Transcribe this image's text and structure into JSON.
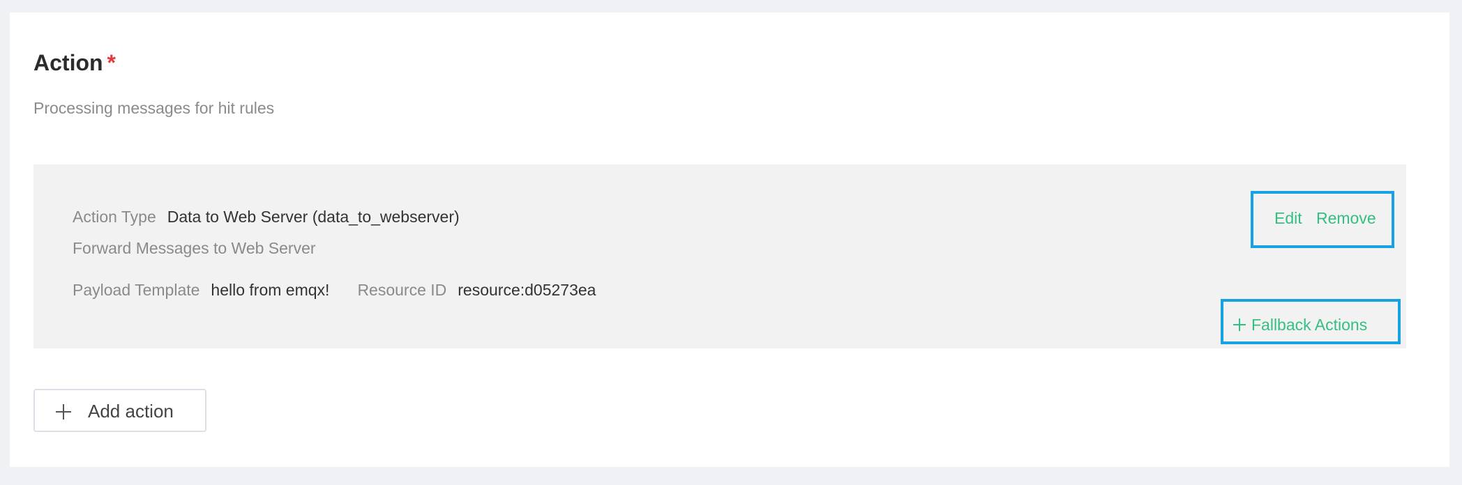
{
  "section": {
    "title": "Action",
    "required_mark": "*",
    "subtitle": "Processing messages for hit rules"
  },
  "action": {
    "type_label": "Action Type",
    "type_value": "Data to Web Server (data_to_webserver)",
    "description": "Forward Messages to Web Server",
    "payload_label": "Payload Template",
    "payload_value": "hello from emqx!",
    "resource_label": "Resource ID",
    "resource_value": "resource:d05273ea",
    "edit_label": "Edit",
    "remove_label": "Remove",
    "fallback_label": "Fallback Actions",
    "fallback_icon": "plus-icon"
  },
  "add_action": {
    "label": "Add action",
    "icon": "plus-icon"
  },
  "colors": {
    "link": "#34bf82",
    "highlight_border": "#17a2e3",
    "required": "#e5383b",
    "panel_bg": "#f2f2f2",
    "page_bg": "#f0f1f4"
  }
}
